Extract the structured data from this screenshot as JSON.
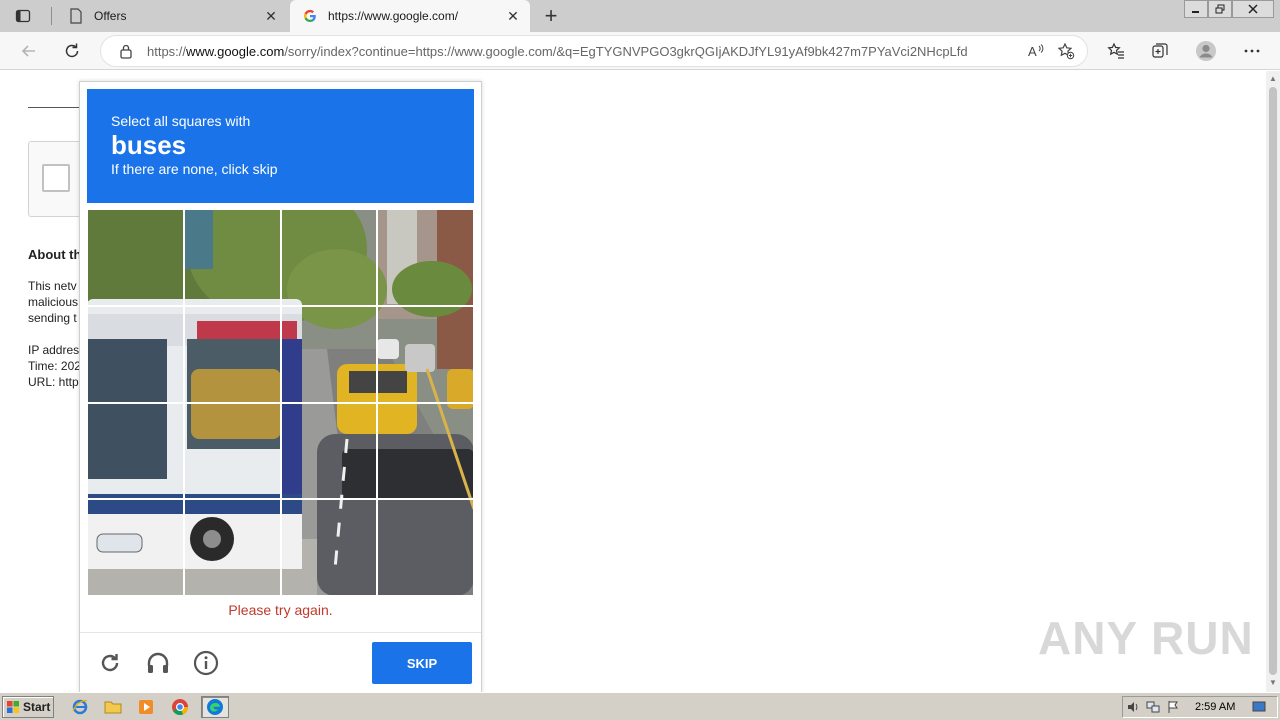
{
  "browser": {
    "tabs": [
      {
        "title": "Offers",
        "icon": "page-icon",
        "active": false
      },
      {
        "title": "https://www.google.com/",
        "icon": "google-g-icon",
        "active": true
      }
    ],
    "address": {
      "url_prefix": "https://",
      "url_host": "www.google.com",
      "url_path": "/sorry/index?continue=https://www.google.com/&q=EgTYGNVPGO3gkrQGIjAKDJfYL91yAf9bk427m7PYaVci2NHcpLfd"
    },
    "accent": "#1a73e8"
  },
  "background_page": {
    "heading": "About th",
    "lines": [
      "This netv",
      "malicious",
      "sending t"
    ],
    "meta": [
      "IP addres",
      "Time: 202",
      "URL: http"
    ]
  },
  "captcha": {
    "prompt_line1": "Select all squares with",
    "target": "buses",
    "prompt_line3": "If there are none, click skip",
    "error": "Please try again.",
    "skip_label": "SKIP",
    "grid_size": 4,
    "header_color": "#1a73e8",
    "error_color": "#c0392b"
  },
  "watermark": "ANY RUN",
  "taskbar": {
    "start_label": "Start",
    "apps": [
      "ie-icon",
      "folder-icon",
      "media-player-icon",
      "chrome-icon",
      "edge-icon"
    ],
    "clock": "2:59 AM"
  }
}
